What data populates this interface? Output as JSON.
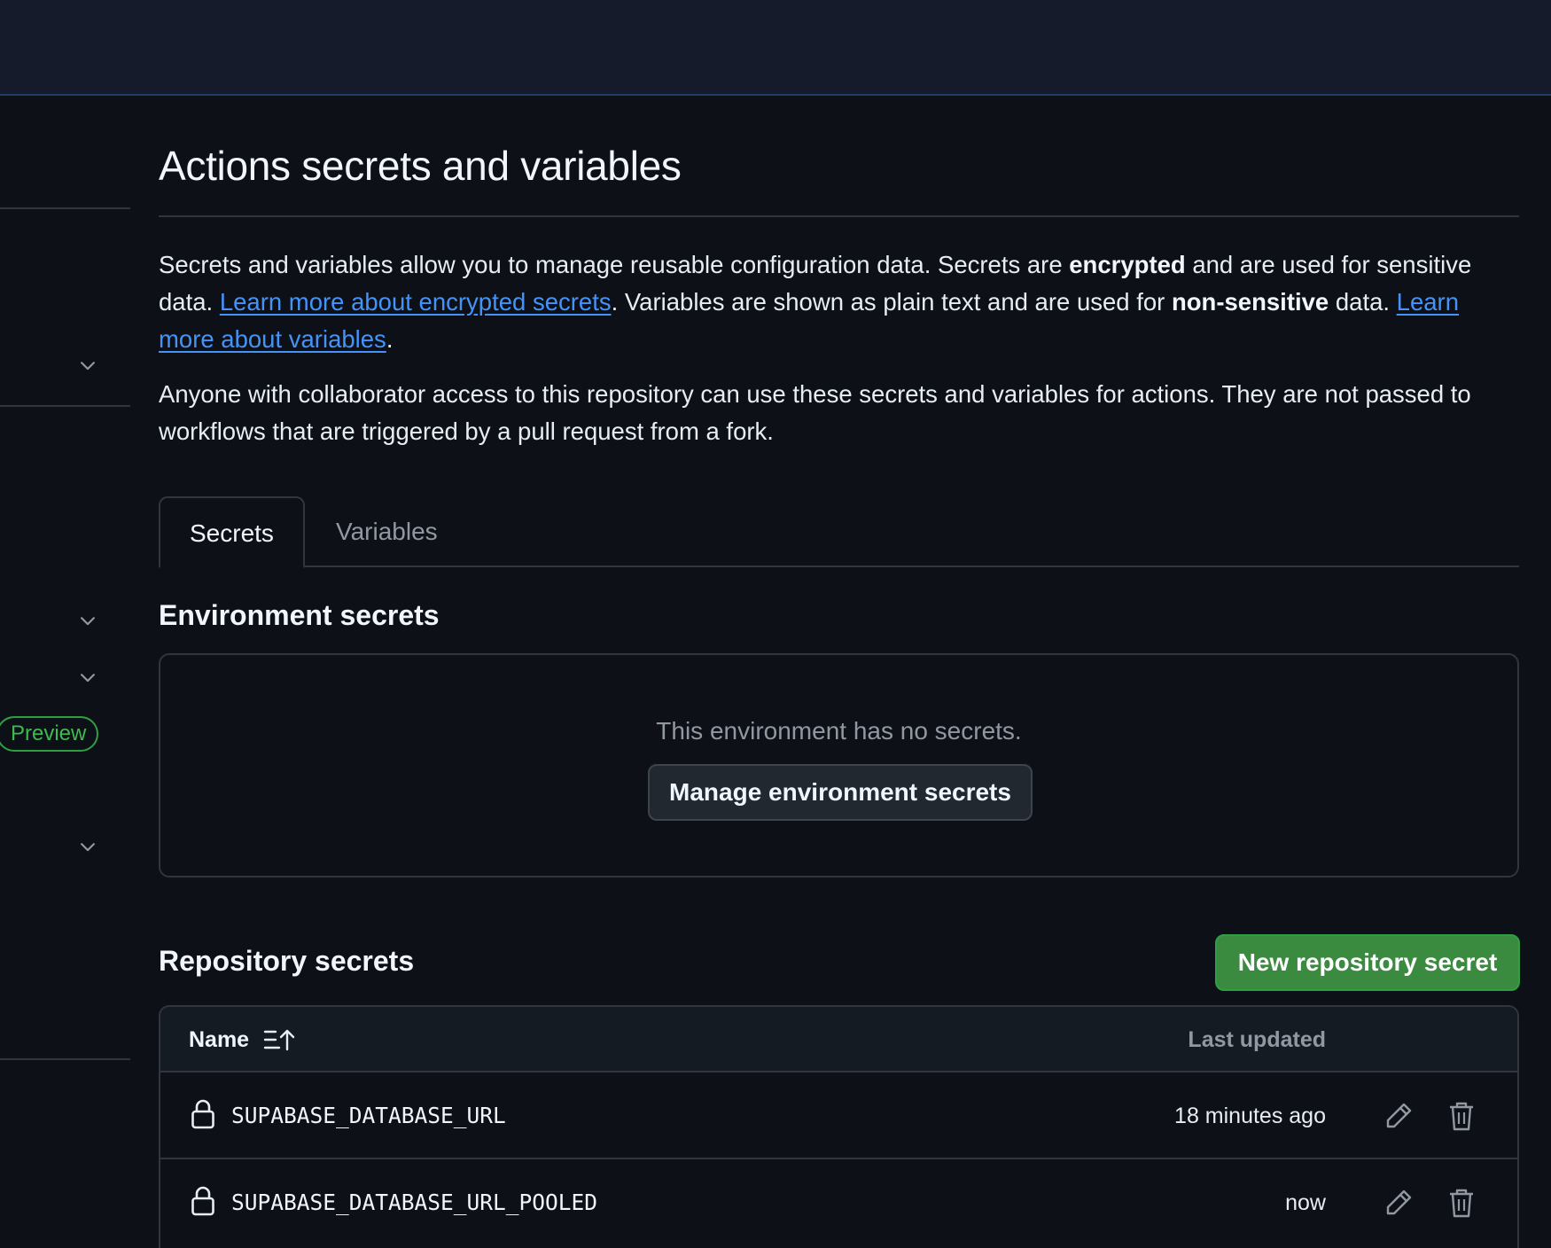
{
  "page": {
    "title": "Actions secrets and variables",
    "intro": {
      "part1": "Secrets and variables allow you to manage reusable configuration data. Secrets are ",
      "encrypted": "encrypted",
      "part2": " and are used for sensitive data. ",
      "link_secrets": "Learn more about encrypted secrets",
      "part3": ". Variables are shown as plain text and are used for ",
      "non_sensitive": "non-sensitive",
      "part4": " data. ",
      "link_variables": "Learn more about variables",
      "part5": "."
    },
    "access_note": "Anyone with collaborator access to this repository can use these secrets and variables for actions. They are not passed to workflows that are triggered by a pull request from a fork."
  },
  "sidebar": {
    "preview_badge": "Preview"
  },
  "tabs": [
    {
      "label": "Secrets",
      "active": true
    },
    {
      "label": "Variables",
      "active": false
    }
  ],
  "environment_secrets": {
    "heading": "Environment secrets",
    "empty_text": "This environment has no secrets.",
    "manage_button": "Manage environment secrets"
  },
  "repository_secrets": {
    "heading": "Repository secrets",
    "new_button": "New repository secret",
    "columns": {
      "name": "Name",
      "last_updated": "Last updated"
    },
    "rows": [
      {
        "name": "SUPABASE_DATABASE_URL",
        "updated": "18 minutes ago"
      },
      {
        "name": "SUPABASE_DATABASE_URL_POOLED",
        "updated": "now"
      }
    ]
  },
  "colors": {
    "background": "#0d1117",
    "link": "#4493f8",
    "primary_button": "#3a8a3f",
    "preview_badge": "#3fb950"
  }
}
